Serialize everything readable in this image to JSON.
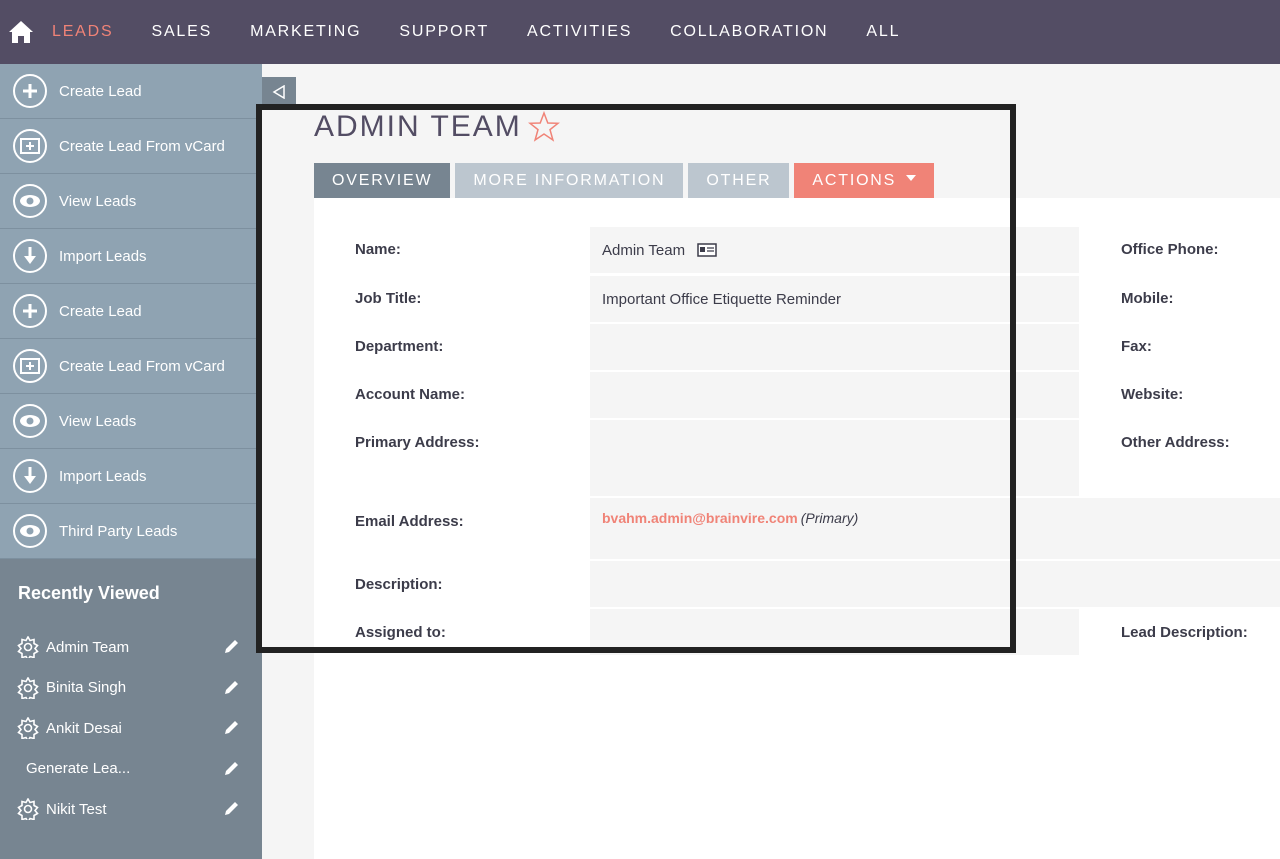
{
  "topnav": {
    "items": [
      {
        "label": "LEADS",
        "active": true
      },
      {
        "label": "SALES"
      },
      {
        "label": "MARKETING"
      },
      {
        "label": "SUPPORT"
      },
      {
        "label": "ACTIVITIES"
      },
      {
        "label": "COLLABORATION"
      },
      {
        "label": "ALL"
      }
    ]
  },
  "sidebar": {
    "actions": [
      {
        "label": "Create Lead",
        "icon": "plus-circle-icon"
      },
      {
        "label": "Create Lead From vCard",
        "icon": "vcard-plus-icon"
      },
      {
        "label": "View Leads",
        "icon": "eye-icon"
      },
      {
        "label": "Import Leads",
        "icon": "download-arrow-icon"
      },
      {
        "label": "Create Lead",
        "icon": "plus-circle-icon"
      },
      {
        "label": "Create Lead From vCard",
        "icon": "vcard-plus-icon"
      },
      {
        "label": "View Leads",
        "icon": "eye-icon"
      },
      {
        "label": "Import Leads",
        "icon": "download-arrow-icon"
      },
      {
        "label": "Third Party Leads",
        "icon": "eye-icon"
      }
    ],
    "recent_title": "Recently Viewed",
    "recent": [
      {
        "label": "Admin Team",
        "icon": true
      },
      {
        "label": "Binita Singh",
        "icon": true
      },
      {
        "label": "Ankit Desai",
        "icon": true
      },
      {
        "label": "Generate Lea...",
        "icon": false
      },
      {
        "label": "Nikit Test",
        "icon": true
      }
    ]
  },
  "main": {
    "title": "ADMIN TEAM",
    "tabs": {
      "overview": "OVERVIEW",
      "more": "MORE INFORMATION",
      "other": "OTHER",
      "actions": "ACTIONS"
    },
    "fields": {
      "name_label": "Name:",
      "name_value": "Admin Team",
      "job_label": "Job Title:",
      "job_value": "Important Office Etiquette Reminder",
      "department_label": "Department:",
      "account_label": "Account Name:",
      "primary_address_label": "Primary Address:",
      "email_label": "Email Address:",
      "email_value": "bvahm.admin@brainvire.com",
      "email_primary": "(Primary)",
      "description_label": "Description:",
      "assigned_label": "Assigned to:",
      "office_phone_label": "Office Phone:",
      "mobile_label": "Mobile:",
      "fax_label": "Fax:",
      "website_label": "Website:",
      "other_address_label": "Other Address:",
      "lead_description_label": "Lead Description:"
    }
  },
  "colors": {
    "nav_bg": "#534d64",
    "accent": "#f08377",
    "sidebar_bg": "#8fa3b2",
    "recent_bg": "#778591"
  }
}
